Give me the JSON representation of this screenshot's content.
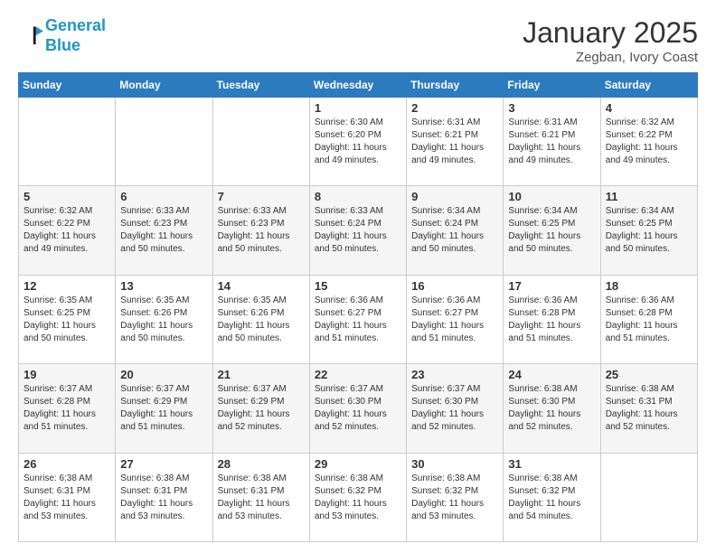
{
  "header": {
    "logo_line1": "General",
    "logo_line2": "Blue",
    "title": "January 2025",
    "subtitle": "Zegban, Ivory Coast"
  },
  "calendar": {
    "days_of_week": [
      "Sunday",
      "Monday",
      "Tuesday",
      "Wednesday",
      "Thursday",
      "Friday",
      "Saturday"
    ],
    "weeks": [
      [
        {
          "day": "",
          "info": ""
        },
        {
          "day": "",
          "info": ""
        },
        {
          "day": "",
          "info": ""
        },
        {
          "day": "1",
          "info": "Sunrise: 6:30 AM\nSunset: 6:20 PM\nDaylight: 11 hours and 49 minutes."
        },
        {
          "day": "2",
          "info": "Sunrise: 6:31 AM\nSunset: 6:21 PM\nDaylight: 11 hours and 49 minutes."
        },
        {
          "day": "3",
          "info": "Sunrise: 6:31 AM\nSunset: 6:21 PM\nDaylight: 11 hours and 49 minutes."
        },
        {
          "day": "4",
          "info": "Sunrise: 6:32 AM\nSunset: 6:22 PM\nDaylight: 11 hours and 49 minutes."
        }
      ],
      [
        {
          "day": "5",
          "info": "Sunrise: 6:32 AM\nSunset: 6:22 PM\nDaylight: 11 hours and 49 minutes."
        },
        {
          "day": "6",
          "info": "Sunrise: 6:33 AM\nSunset: 6:23 PM\nDaylight: 11 hours and 50 minutes."
        },
        {
          "day": "7",
          "info": "Sunrise: 6:33 AM\nSunset: 6:23 PM\nDaylight: 11 hours and 50 minutes."
        },
        {
          "day": "8",
          "info": "Sunrise: 6:33 AM\nSunset: 6:24 PM\nDaylight: 11 hours and 50 minutes."
        },
        {
          "day": "9",
          "info": "Sunrise: 6:34 AM\nSunset: 6:24 PM\nDaylight: 11 hours and 50 minutes."
        },
        {
          "day": "10",
          "info": "Sunrise: 6:34 AM\nSunset: 6:25 PM\nDaylight: 11 hours and 50 minutes."
        },
        {
          "day": "11",
          "info": "Sunrise: 6:34 AM\nSunset: 6:25 PM\nDaylight: 11 hours and 50 minutes."
        }
      ],
      [
        {
          "day": "12",
          "info": "Sunrise: 6:35 AM\nSunset: 6:25 PM\nDaylight: 11 hours and 50 minutes."
        },
        {
          "day": "13",
          "info": "Sunrise: 6:35 AM\nSunset: 6:26 PM\nDaylight: 11 hours and 50 minutes."
        },
        {
          "day": "14",
          "info": "Sunrise: 6:35 AM\nSunset: 6:26 PM\nDaylight: 11 hours and 50 minutes."
        },
        {
          "day": "15",
          "info": "Sunrise: 6:36 AM\nSunset: 6:27 PM\nDaylight: 11 hours and 51 minutes."
        },
        {
          "day": "16",
          "info": "Sunrise: 6:36 AM\nSunset: 6:27 PM\nDaylight: 11 hours and 51 minutes."
        },
        {
          "day": "17",
          "info": "Sunrise: 6:36 AM\nSunset: 6:28 PM\nDaylight: 11 hours and 51 minutes."
        },
        {
          "day": "18",
          "info": "Sunrise: 6:36 AM\nSunset: 6:28 PM\nDaylight: 11 hours and 51 minutes."
        }
      ],
      [
        {
          "day": "19",
          "info": "Sunrise: 6:37 AM\nSunset: 6:28 PM\nDaylight: 11 hours and 51 minutes."
        },
        {
          "day": "20",
          "info": "Sunrise: 6:37 AM\nSunset: 6:29 PM\nDaylight: 11 hours and 51 minutes."
        },
        {
          "day": "21",
          "info": "Sunrise: 6:37 AM\nSunset: 6:29 PM\nDaylight: 11 hours and 52 minutes."
        },
        {
          "day": "22",
          "info": "Sunrise: 6:37 AM\nSunset: 6:30 PM\nDaylight: 11 hours and 52 minutes."
        },
        {
          "day": "23",
          "info": "Sunrise: 6:37 AM\nSunset: 6:30 PM\nDaylight: 11 hours and 52 minutes."
        },
        {
          "day": "24",
          "info": "Sunrise: 6:38 AM\nSunset: 6:30 PM\nDaylight: 11 hours and 52 minutes."
        },
        {
          "day": "25",
          "info": "Sunrise: 6:38 AM\nSunset: 6:31 PM\nDaylight: 11 hours and 52 minutes."
        }
      ],
      [
        {
          "day": "26",
          "info": "Sunrise: 6:38 AM\nSunset: 6:31 PM\nDaylight: 11 hours and 53 minutes."
        },
        {
          "day": "27",
          "info": "Sunrise: 6:38 AM\nSunset: 6:31 PM\nDaylight: 11 hours and 53 minutes."
        },
        {
          "day": "28",
          "info": "Sunrise: 6:38 AM\nSunset: 6:31 PM\nDaylight: 11 hours and 53 minutes."
        },
        {
          "day": "29",
          "info": "Sunrise: 6:38 AM\nSunset: 6:32 PM\nDaylight: 11 hours and 53 minutes."
        },
        {
          "day": "30",
          "info": "Sunrise: 6:38 AM\nSunset: 6:32 PM\nDaylight: 11 hours and 53 minutes."
        },
        {
          "day": "31",
          "info": "Sunrise: 6:38 AM\nSunset: 6:32 PM\nDaylight: 11 hours and 54 minutes."
        },
        {
          "day": "",
          "info": ""
        }
      ]
    ]
  }
}
